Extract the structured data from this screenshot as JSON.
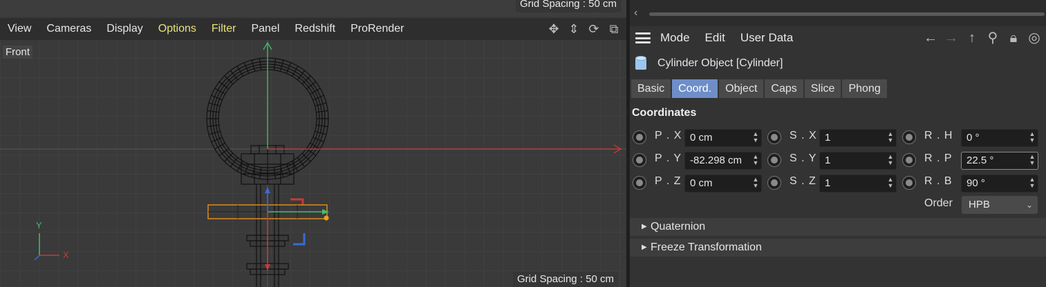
{
  "viewport": {
    "grid_spacing_top": "Grid Spacing : 50 cm",
    "grid_spacing_bottom": "Grid Spacing : 50 cm",
    "menus": [
      {
        "label": "View",
        "highlight": false
      },
      {
        "label": "Cameras",
        "highlight": false
      },
      {
        "label": "Display",
        "highlight": false
      },
      {
        "label": "Options",
        "highlight": true
      },
      {
        "label": "Filter",
        "highlight": true
      },
      {
        "label": "Panel",
        "highlight": false
      },
      {
        "label": "Redshift",
        "highlight": false
      },
      {
        "label": "ProRender",
        "highlight": false
      }
    ],
    "tools": [
      "move-view-icon",
      "dolly-view-icon",
      "rotate-view-icon",
      "maximize-view-icon"
    ],
    "view_name": "Front",
    "axis_y_label": "Y",
    "axis_x_label": "X",
    "colors": {
      "x_axis": "#c83a3a",
      "y_axis": "#3fbf6a",
      "z_axis": "#3a6ad8",
      "selection": "#e08a1e",
      "menu_highlight": "#e9e27a"
    }
  },
  "panel": {
    "menu": {
      "mode": "Mode",
      "edit": "Edit",
      "user_data": "User Data"
    },
    "nav_icons": [
      "arrow-left-icon",
      "arrow-right-icon",
      "arrow-up-icon",
      "search-icon",
      "lock-icon",
      "target-icon"
    ],
    "object_title": "Cylinder Object [Cylinder]",
    "tabs": [
      {
        "label": "Basic",
        "active": false
      },
      {
        "label": "Coord.",
        "active": true
      },
      {
        "label": "Object",
        "active": false
      },
      {
        "label": "Caps",
        "active": false
      },
      {
        "label": "Slice",
        "active": false
      },
      {
        "label": "Phong",
        "active": false
      }
    ],
    "section": "Coordinates",
    "coords": {
      "px": {
        "label": "P . X",
        "value": "0 cm"
      },
      "py": {
        "label": "P . Y",
        "value": "-82.298 cm"
      },
      "pz": {
        "label": "P . Z",
        "value": "0 cm"
      },
      "sx": {
        "label": "S . X",
        "value": "1"
      },
      "sy": {
        "label": "S . Y",
        "value": "1"
      },
      "sz": {
        "label": "S . Z",
        "value": "1"
      },
      "rh": {
        "label": "R . H",
        "value": "0 °"
      },
      "rp": {
        "label": "R . P",
        "value": "22.5 °"
      },
      "rb": {
        "label": "R . B",
        "value": "90 °"
      }
    },
    "order_label": "Order",
    "order_value": "HPB",
    "groups": {
      "quaternion": "Quaternion",
      "freeze": "Freeze Transformation"
    },
    "colors": {
      "active_tab": "#6f8ec8"
    }
  }
}
